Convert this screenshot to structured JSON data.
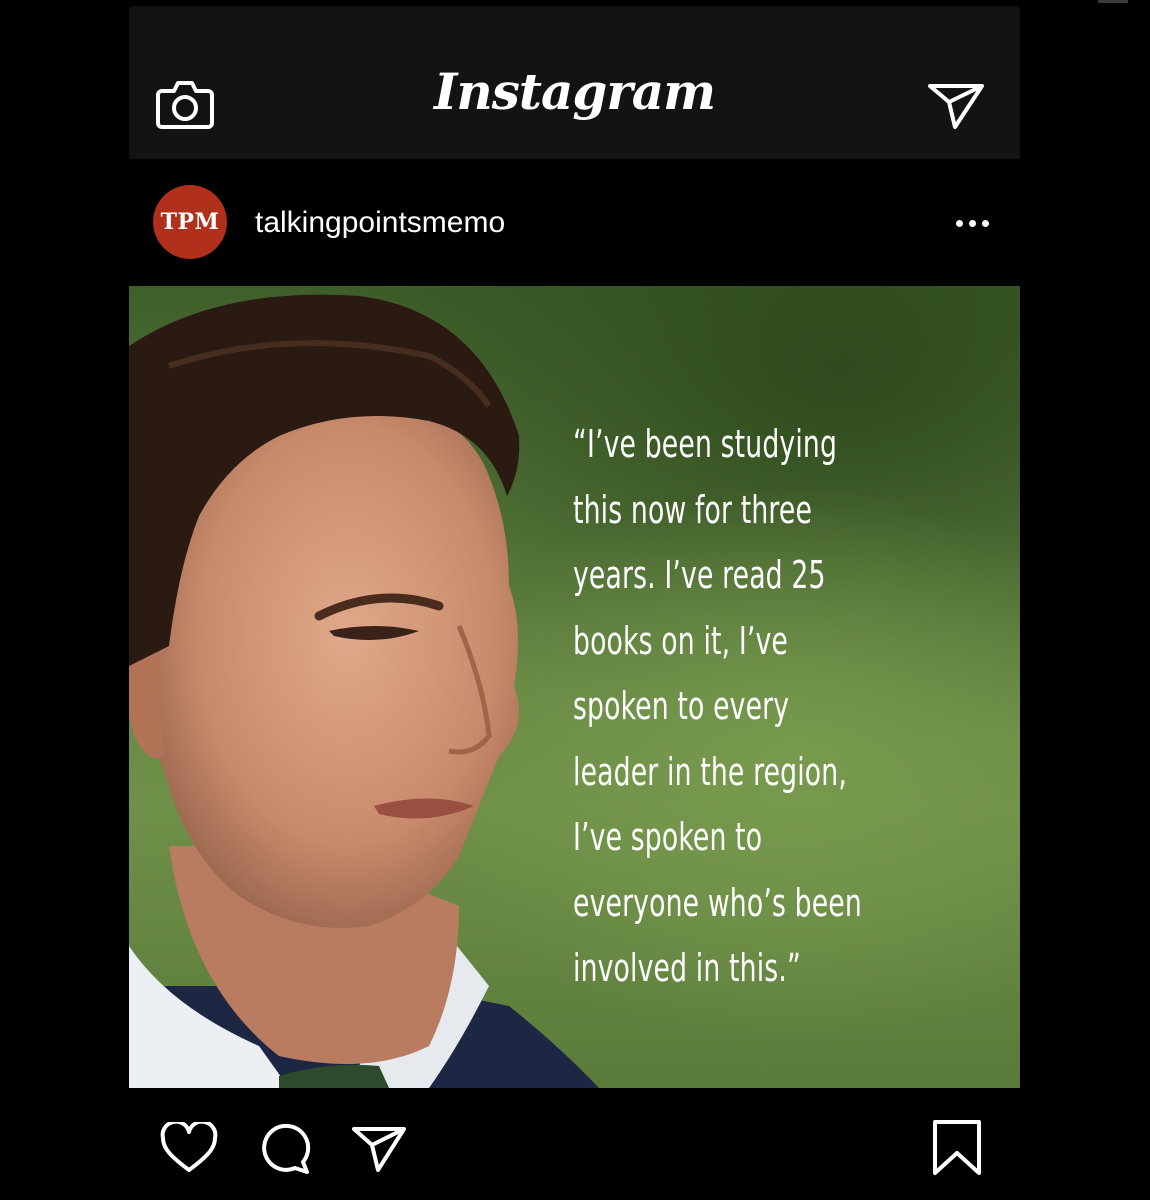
{
  "app": {
    "brand_title": "Instagram"
  },
  "topbar": {
    "left_icon": "camera-icon",
    "right_icon": "direct-send-icon"
  },
  "post": {
    "avatar_text": "TPM",
    "avatar_color": "#b0301c",
    "username": "talkingpointsmemo",
    "more_icon": "more-dots-icon",
    "quote": "“I’ve been studying\nthis now for three\nyears. I’ve read 25\nbooks on it, I’ve\nspoken to every\nleader in the region,\nI’ve spoken to\neveryone who’s been\ninvolved in this.”"
  },
  "actions": {
    "icons": [
      "heart-icon",
      "comment-icon",
      "share-icon",
      "bookmark-icon"
    ]
  },
  "colors": {
    "topbar_bg": "#131313",
    "background": "#000000",
    "photo_green": "#6f9048"
  }
}
